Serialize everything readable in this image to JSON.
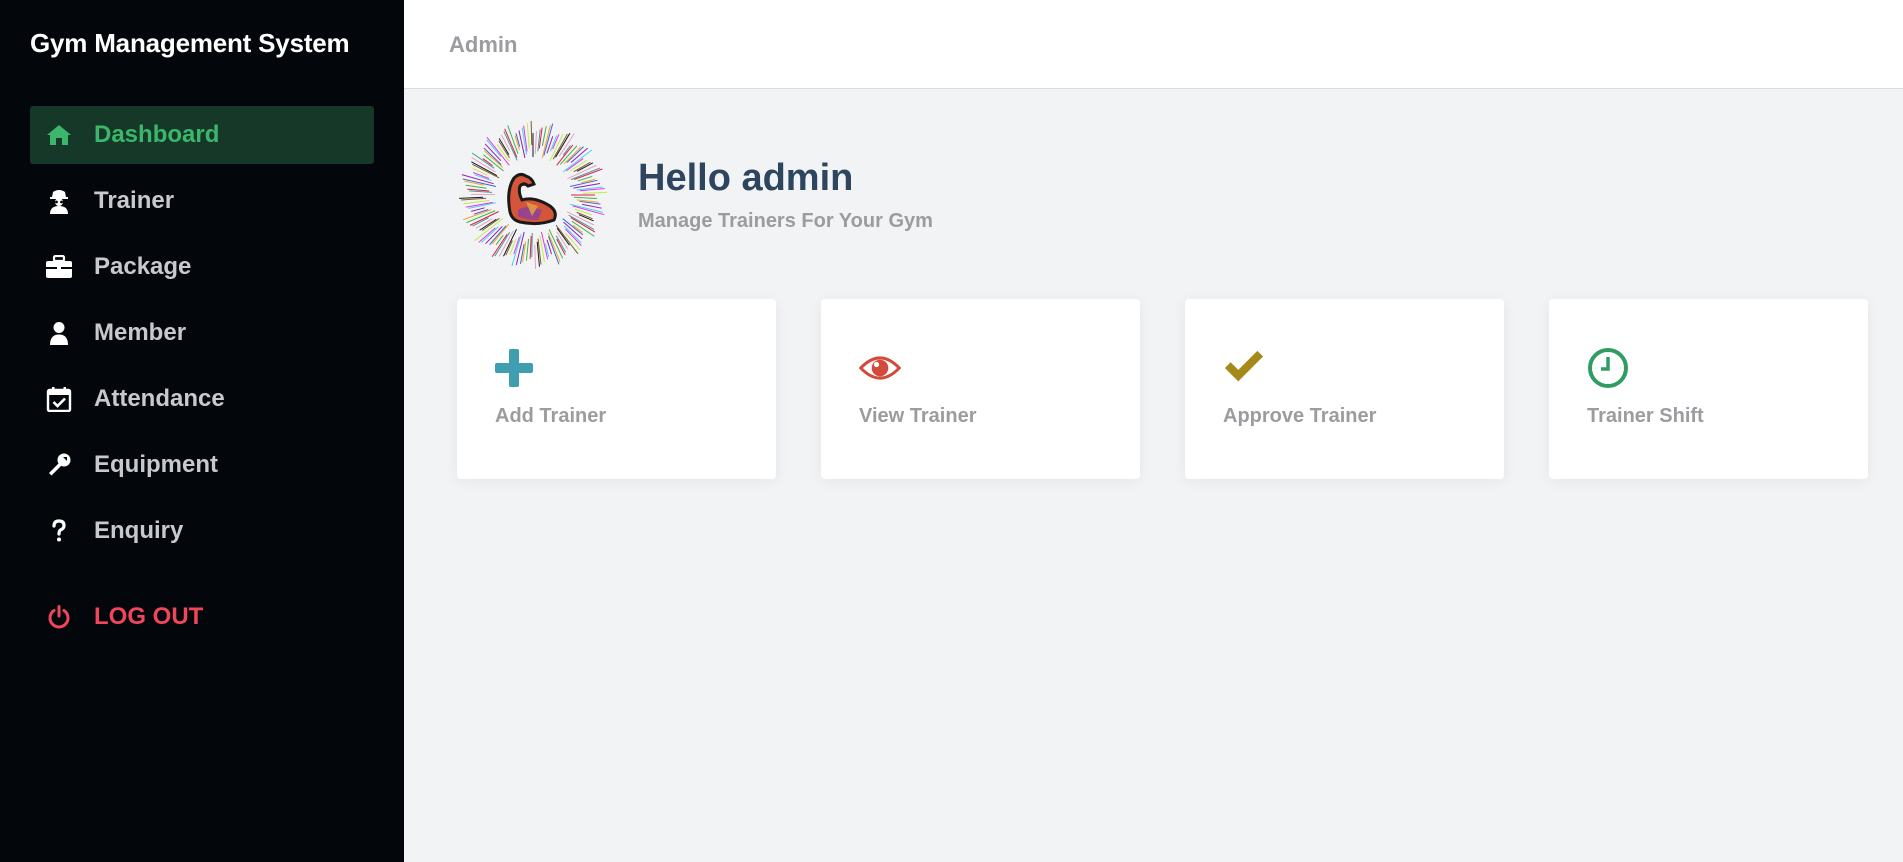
{
  "app": {
    "title": "Gym Management System"
  },
  "sidebar": {
    "items": [
      {
        "label": "Dashboard",
        "icon": "home-icon",
        "active": true
      },
      {
        "label": "Trainer",
        "icon": "spy-icon"
      },
      {
        "label": "Package",
        "icon": "briefcase-icon"
      },
      {
        "label": "Member",
        "icon": "user-icon"
      },
      {
        "label": "Attendance",
        "icon": "calendar-check-icon"
      },
      {
        "label": "Equipment",
        "icon": "wrench-icon"
      },
      {
        "label": "Enquiry",
        "icon": "question-icon"
      }
    ],
    "logout": {
      "label": "LOG OUT",
      "icon": "power-icon"
    }
  },
  "header": {
    "breadcrumb": "Admin"
  },
  "hero": {
    "title": "Hello admin",
    "subtitle": "Manage Trainers For Your Gym",
    "logo_icon": "flexed-arm-logo"
  },
  "cards": [
    {
      "label": "Add Trainer",
      "icon": "plus-icon",
      "color": "#3f9fb1"
    },
    {
      "label": "View Trainer",
      "icon": "eye-icon",
      "color": "#d24a3c"
    },
    {
      "label": "Approve Trainer",
      "icon": "check-icon",
      "color": "#a58a1a"
    },
    {
      "label": "Trainer Shift",
      "icon": "clock-icon",
      "color": "#2f9d62"
    }
  ],
  "colors": {
    "sidebar_bg": "#03060b",
    "active": "#3cb66b",
    "logout": "#f0465a",
    "title": "#2e4560"
  }
}
